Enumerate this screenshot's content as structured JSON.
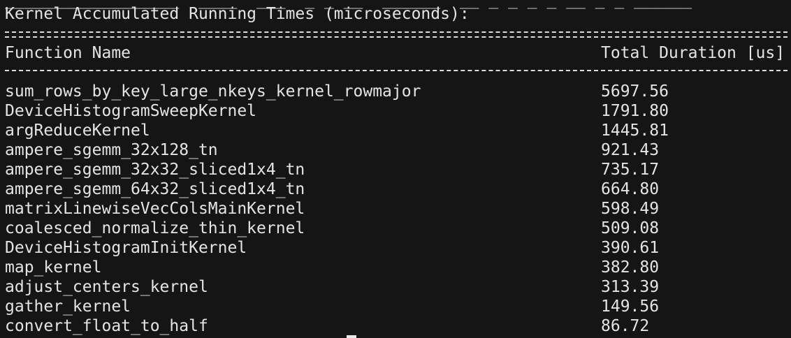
{
  "terminal": {
    "clipped_line": "__________________  ____  ___  _ _ __  ______  __ _ _ _ _ __ _ _ ______",
    "title": "Kernel Accumulated Running Times (microseconds):",
    "table": {
      "headers": {
        "name": "Function Name",
        "duration": "Total Duration [us]"
      },
      "rows": [
        {
          "name": "sum_rows_by_key_large_nkeys_kernel_rowmajor",
          "duration": "5697.56"
        },
        {
          "name": "DeviceHistogramSweepKernel",
          "duration": "1791.80"
        },
        {
          "name": "argReduceKernel",
          "duration": "1445.81"
        },
        {
          "name": "ampere_sgemm_32x128_tn",
          "duration": "921.43"
        },
        {
          "name": "ampere_sgemm_32x32_sliced1x4_tn",
          "duration": "735.17"
        },
        {
          "name": "ampere_sgemm_64x32_sliced1x4_tn",
          "duration": "664.80"
        },
        {
          "name": "matrixLinewiseVecColsMainKernel",
          "duration": "598.49"
        },
        {
          "name": "coalesced_normalize_thin_kernel",
          "duration": "509.08"
        },
        {
          "name": "DeviceHistogramInitKernel",
          "duration": "390.61"
        },
        {
          "name": "map_kernel",
          "duration": "382.80"
        },
        {
          "name": "adjust_centers_kernel",
          "duration": "313.39"
        },
        {
          "name": "gather_kernel",
          "duration": "149.56"
        },
        {
          "name": "convert_float_to_half",
          "duration": "86.72"
        }
      ]
    }
  },
  "colors": {
    "background": "#151515",
    "foreground": "#e4e4e4"
  }
}
